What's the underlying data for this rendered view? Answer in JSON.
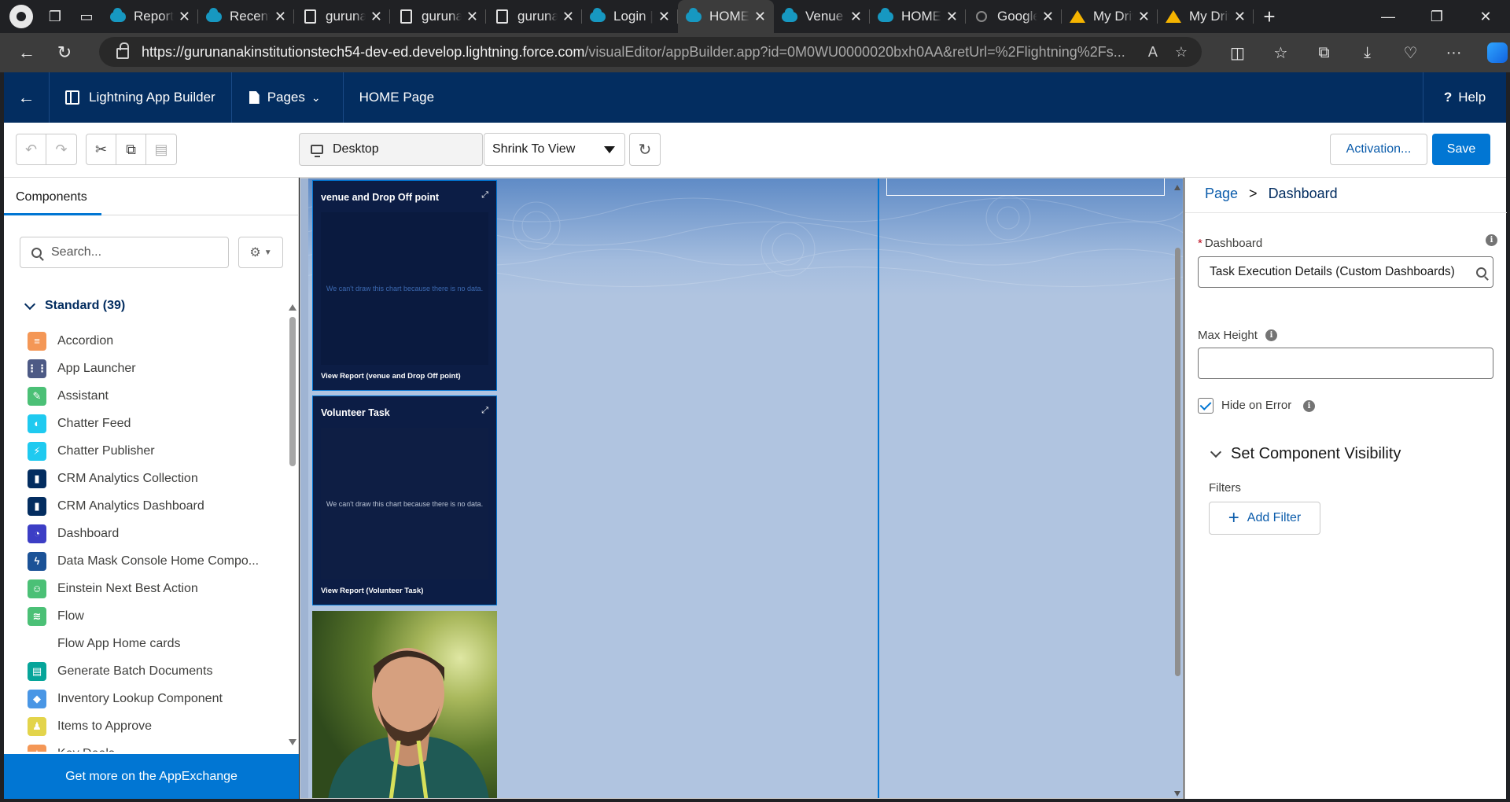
{
  "browser": {
    "tabs": [
      {
        "title": "Report",
        "icon": "salesforce-cloud-icon",
        "active": false
      },
      {
        "title": "Recent",
        "icon": "salesforce-cloud-icon",
        "active": false
      },
      {
        "title": "guruna",
        "icon": "document-icon",
        "active": false
      },
      {
        "title": "guruna",
        "icon": "document-icon",
        "active": false
      },
      {
        "title": "guruna",
        "icon": "document-icon",
        "active": false
      },
      {
        "title": "Login |",
        "icon": "salesforce-cloud-icon",
        "active": false
      },
      {
        "title": "HOME",
        "icon": "salesforce-cloud-icon",
        "active": true
      },
      {
        "title": "Venue |",
        "icon": "salesforce-cloud-icon",
        "active": false
      },
      {
        "title": "HOME",
        "icon": "salesforce-cloud-icon",
        "active": false
      },
      {
        "title": "Google",
        "icon": "search-icon",
        "active": false
      },
      {
        "title": "My Driv",
        "icon": "google-drive-icon",
        "active": false
      },
      {
        "title": "My Driv",
        "icon": "google-drive-icon",
        "active": false
      }
    ],
    "url_host": "https://gurunanakinstitutionstech54-dev-ed.develop.lightning.force.com",
    "url_path": "/visualEditor/appBuilder.app?id=0M0WU0000020bxh0AA&retUrl=%2Flightning%2Fs..."
  },
  "header": {
    "app_name": "Lightning App Builder",
    "pages_label": "Pages",
    "page_title": "HOME Page",
    "help_label": "Help"
  },
  "toolbar": {
    "device": "Desktop",
    "zoom": "Shrink To View",
    "activation_label": "Activation...",
    "save_label": "Save"
  },
  "left_panel": {
    "tab_label": "Components",
    "search_placeholder": "Search...",
    "section_label": "Standard (39)",
    "components": [
      {
        "label": "Accordion",
        "icon": "accordion-icon",
        "color": "#f49756"
      },
      {
        "label": "App Launcher",
        "icon": "app-launcher-icon",
        "color": "#4d5a85"
      },
      {
        "label": "Assistant",
        "icon": "assistant-icon",
        "color": "#4bc076"
      },
      {
        "label": "Chatter Feed",
        "icon": "chatter-feed-icon",
        "color": "#1fcaf0"
      },
      {
        "label": "Chatter Publisher",
        "icon": "chatter-publisher-icon",
        "color": "#1fcaf0"
      },
      {
        "label": "CRM Analytics Collection",
        "icon": "analytics-icon",
        "color": "#032d60"
      },
      {
        "label": "CRM Analytics Dashboard",
        "icon": "analytics-icon",
        "color": "#032d60"
      },
      {
        "label": "Dashboard",
        "icon": "dashboard-icon",
        "color": "#3c3ec5"
      },
      {
        "label": "Data Mask Console Home Compo...",
        "icon": "lightning-icon",
        "color": "#1b5297"
      },
      {
        "label": "Einstein Next Best Action",
        "icon": "einstein-icon",
        "color": "#4bc076"
      },
      {
        "label": "Flow",
        "icon": "flow-icon",
        "color": "#4bc076"
      },
      {
        "label": "Flow App Home cards",
        "icon": "",
        "color": ""
      },
      {
        "label": "Generate Batch Documents",
        "icon": "document-icon",
        "color": "#06a59a"
      },
      {
        "label": "Inventory Lookup Component",
        "icon": "cube-icon",
        "color": "#4996e5"
      },
      {
        "label": "Items to Approve",
        "icon": "approval-icon",
        "color": "#e3d44b"
      },
      {
        "label": "Key Deals",
        "icon": "key-deals-icon",
        "color": "#f49756"
      }
    ],
    "appexchange_label": "Get more on the AppExchange"
  },
  "canvas": {
    "cards": [
      {
        "title": "venue and Drop Off point",
        "message": "We can't draw this chart because there is no data.",
        "footer": "View Report (venue and Drop Off point)"
      },
      {
        "title": "Volunteer Task",
        "message": "We can't draw this chart because there is no data.",
        "footer": "View Report (Volunteer Task)"
      }
    ]
  },
  "right_panel": {
    "breadcrumb_root": "Page",
    "breadcrumb_current": "Dashboard",
    "dashboard_label": "Dashboard",
    "dashboard_value": "Task Execution Details (Custom Dashboards)",
    "max_height_label": "Max Height",
    "max_height_value": "",
    "hide_on_error_label": "Hide on Error",
    "hide_on_error_checked": true,
    "visibility_label": "Set Component Visibility",
    "filters_label": "Filters",
    "add_filter_label": "Add Filter"
  }
}
